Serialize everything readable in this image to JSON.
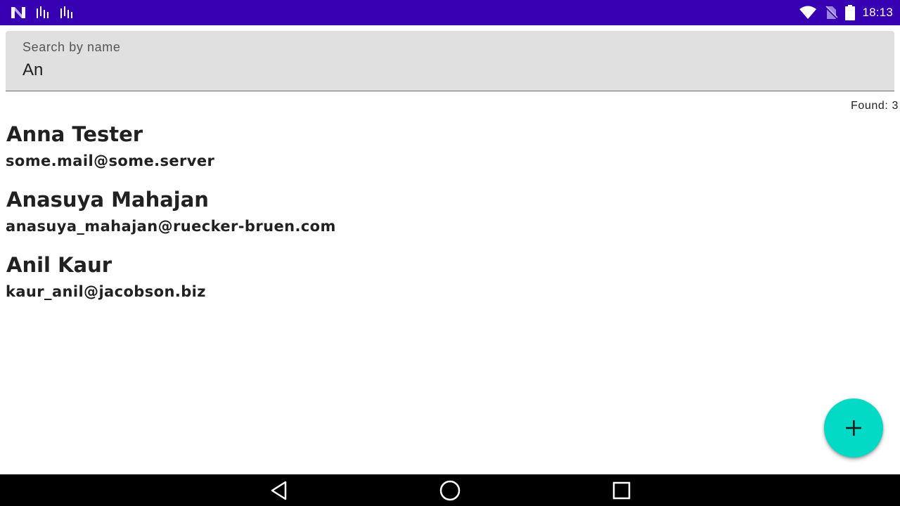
{
  "status_bar": {
    "time": "18:13",
    "background": "#3700b3",
    "left_icons": [
      "app-logo-icon",
      "signal-pulse-icon",
      "signal-pulse-icon"
    ],
    "right_icons": [
      "wifi-icon",
      "no-sim-icon",
      "battery-icon"
    ]
  },
  "search": {
    "label": "Search by name",
    "value": "An"
  },
  "results": {
    "found_label": "Found: 3"
  },
  "contacts": [
    {
      "name": "Anna Tester",
      "email": "some.mail@some.server"
    },
    {
      "name": "Anasuya Mahajan",
      "email": "anasuya_mahajan@ruecker-bruen.com"
    },
    {
      "name": "Anil Kaur",
      "email": "kaur_anil@jacobson.biz"
    }
  ],
  "fab": {
    "icon": "plus-icon",
    "color": "#03dac5"
  },
  "nav_bar": {
    "buttons": [
      "back-icon",
      "home-icon",
      "recents-icon"
    ]
  }
}
